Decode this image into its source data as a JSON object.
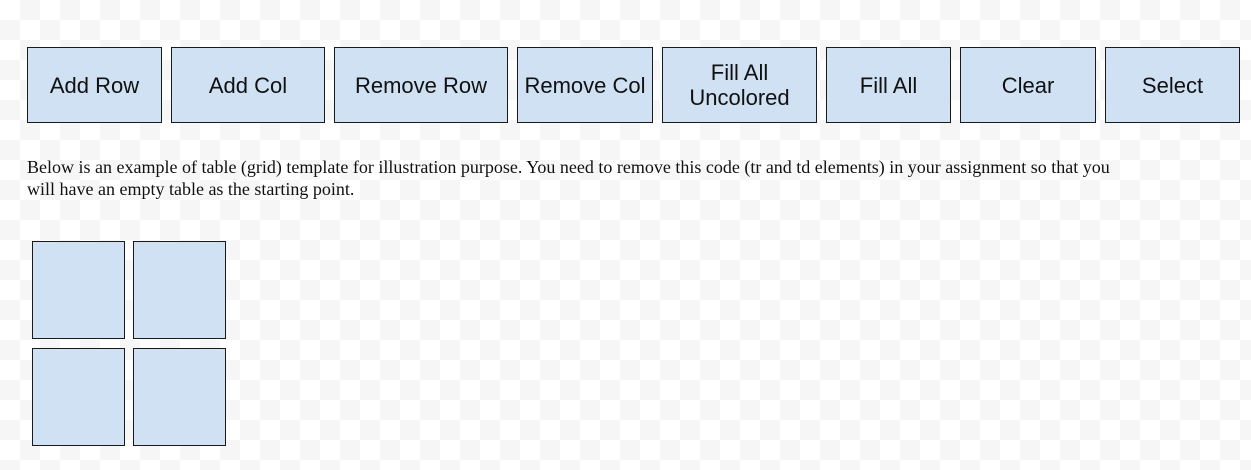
{
  "toolbar": {
    "buttons": [
      {
        "id": "add-row",
        "label": "Add Row"
      },
      {
        "id": "add-col",
        "label": "Add Col"
      },
      {
        "id": "remove-row",
        "label": "Remove Row"
      },
      {
        "id": "remove-col",
        "label": "Remove Col"
      },
      {
        "id": "fill-all-uncolored",
        "label": "Fill All Uncolored"
      },
      {
        "id": "fill-all",
        "label": "Fill All"
      },
      {
        "id": "clear",
        "label": "Clear"
      },
      {
        "id": "select",
        "label": "Select"
      }
    ]
  },
  "description": "Below is an example of table (grid) template for illustration purpose. You need to remove this code (tr and td elements) in your assignment so that you will have an empty table as the starting point.",
  "grid": {
    "rows": 2,
    "cols": 2,
    "cell_color": "#cfe1f3"
  },
  "colors": {
    "button_fill": "#cfe1f3",
    "border": "#1a1a1a"
  }
}
